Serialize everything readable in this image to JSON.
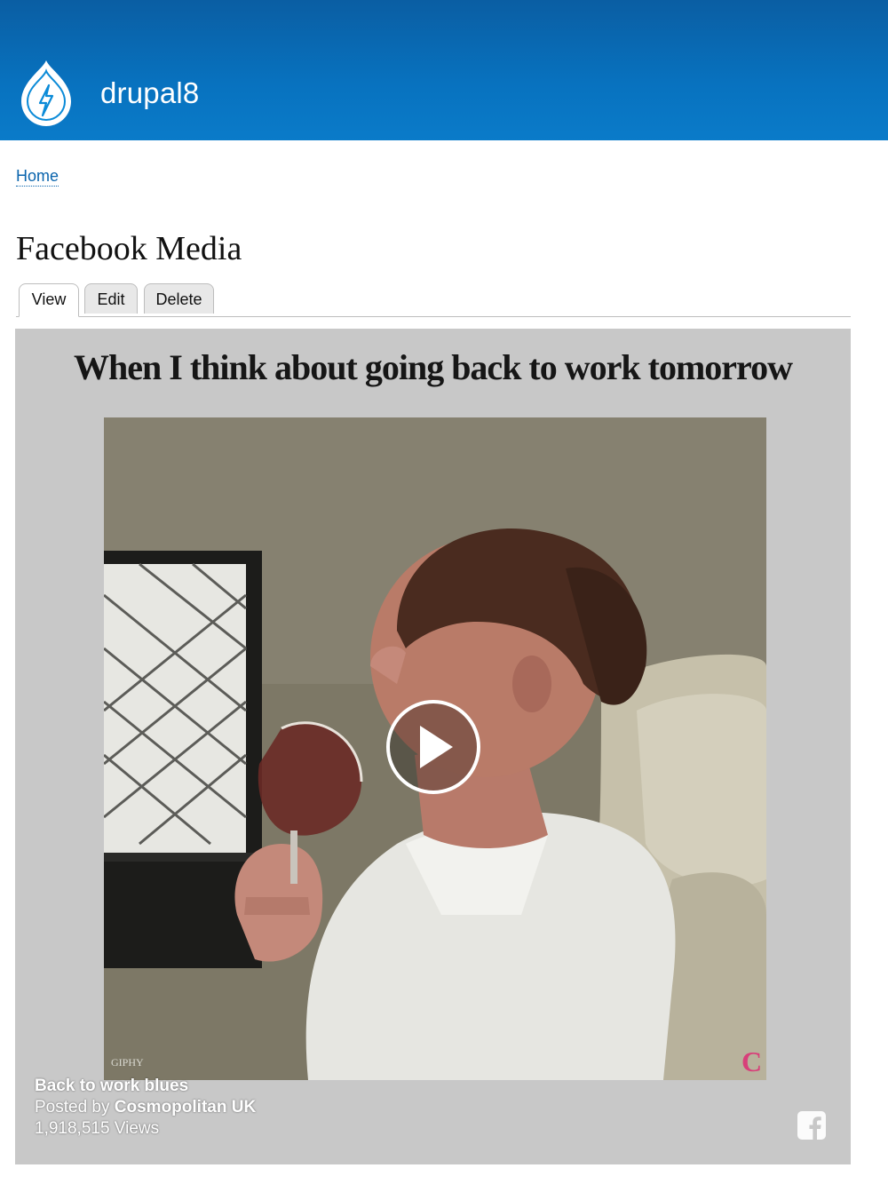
{
  "header": {
    "site_name": "drupal8",
    "brand_color": "#0872bf",
    "logo_icon": "drupal-lightning-drop-icon"
  },
  "breadcrumb": {
    "home_label": "Home"
  },
  "page": {
    "title": "Facebook Media"
  },
  "tabs": [
    {
      "label": "View",
      "active": true
    },
    {
      "label": "Edit",
      "active": false
    },
    {
      "label": "Delete",
      "active": false
    }
  ],
  "video": {
    "caption_text": "When I think about going back to work tomorrow",
    "watermark_giphy": "GIPHY",
    "watermark_brand": "C",
    "play_icon": "play-icon",
    "title": "Back to work blues",
    "posted_by_prefix": "Posted by",
    "posted_by": "Cosmopolitan UK",
    "views": "1,918,515 Views",
    "facebook_icon": "facebook-icon"
  }
}
